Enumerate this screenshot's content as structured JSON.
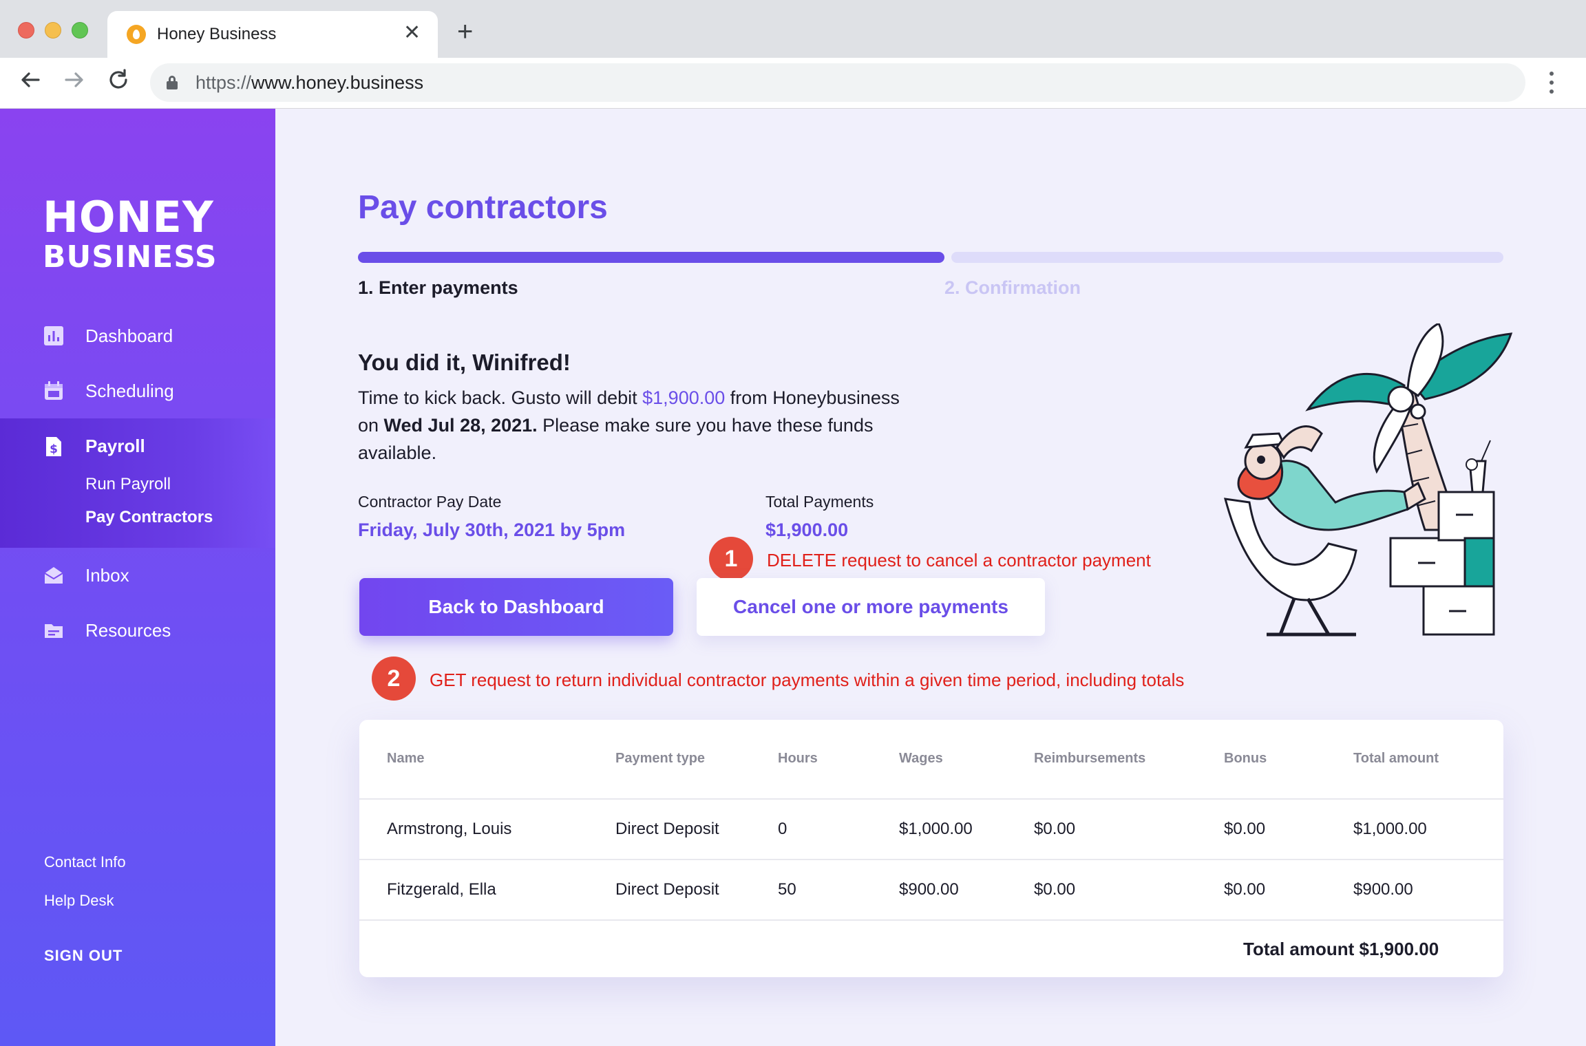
{
  "browser": {
    "tab_title": "Honey Business",
    "url_scheme": "https://",
    "url_host": "www.honey.business",
    "new_tab": "+",
    "close": "✕"
  },
  "sidebar": {
    "logo_line1": "HONEY",
    "logo_line2": "BUSINESS",
    "items": [
      {
        "label": "Dashboard",
        "icon": "bar-chart-icon"
      },
      {
        "label": "Scheduling",
        "icon": "calendar-icon"
      },
      {
        "label": "Payroll",
        "icon": "dollar-document-icon"
      },
      {
        "label": "Inbox",
        "icon": "envelope-icon"
      },
      {
        "label": "Resources",
        "icon": "folder-icon"
      }
    ],
    "payroll_sub": [
      "Run Payroll",
      "Pay Contractors"
    ],
    "footer": [
      "Contact Info",
      "Help Desk"
    ],
    "sign_out": "SIGN OUT"
  },
  "main": {
    "title": "Pay contractors",
    "steps": [
      "1. Enter payments",
      "2. Confirmation"
    ],
    "progress": 0.5,
    "greeting": "You did it, Winifred!",
    "message_part1": "Time to kick back. Gusto will debit ",
    "message_amount": "$1,900.00",
    "message_part2": " from Honeybusiness on ",
    "message_date": "Wed Jul 28, 2021.",
    "message_part3": " Please make sure you have these funds available.",
    "pay_date_label": "Contractor Pay Date",
    "pay_date_value": "Friday, July 30th, 2021 by 5pm",
    "total_label": "Total Payments",
    "total_value": "$1,900.00",
    "back_button": "Back to Dashboard",
    "cancel_button": "Cancel one or more payments"
  },
  "annotations": [
    {
      "number": "1",
      "text": "DELETE request to cancel a contractor payment"
    },
    {
      "number": "2",
      "text": "GET request to return individual contractor payments within a given time period, including totals"
    }
  ],
  "table": {
    "headers": [
      "Name",
      "Payment type",
      "Hours",
      "Wages",
      "Reimbursements",
      "Bonus",
      "Total amount"
    ],
    "rows": [
      [
        "Armstrong, Louis",
        "Direct Deposit",
        "0",
        "$1,000.00",
        "$0.00",
        "$0.00",
        "$1,000.00"
      ],
      [
        "Fitzgerald, Ella",
        "Direct Deposit",
        "50",
        "$900.00",
        "$0.00",
        "$0.00",
        "$900.00"
      ]
    ],
    "total_text": "Total amount $1,900.00"
  },
  "colors": {
    "accent": "#6a4ee8",
    "annotation": "#e0201a",
    "badge": "#e5493a",
    "illustration_teal": "#18a59a",
    "illustration_red": "#e8503e"
  }
}
